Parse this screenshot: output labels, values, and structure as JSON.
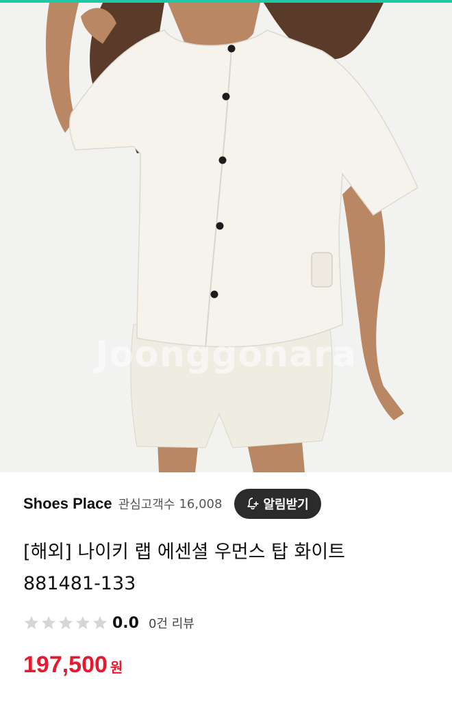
{
  "hero": {
    "watermark": "Joonggonara",
    "image_alt": "model wearing white short-sleeve button shirt and shorts"
  },
  "seller": {
    "name": "Shoes Place",
    "follower_label": "관심고객수",
    "follower_count": "16,008",
    "alarm_button_label": "알림받기",
    "alarm_icon": "bell-plus-icon"
  },
  "product": {
    "title_line1": "[해외] 나이키 랩 에센셜 우먼스 탑 화이트",
    "title_line2": "881481-133"
  },
  "rating": {
    "stars_filled": 0,
    "stars_total": 5,
    "score": "0.0",
    "review_count_label": "0건 리뷰"
  },
  "price": {
    "amount": "197,500",
    "unit": "원"
  },
  "colors": {
    "accent_top": "#1fc7a4",
    "price": "#e8182f",
    "alarm_button_bg": "#2b2b2b",
    "star_empty": "#d6d6d6"
  }
}
